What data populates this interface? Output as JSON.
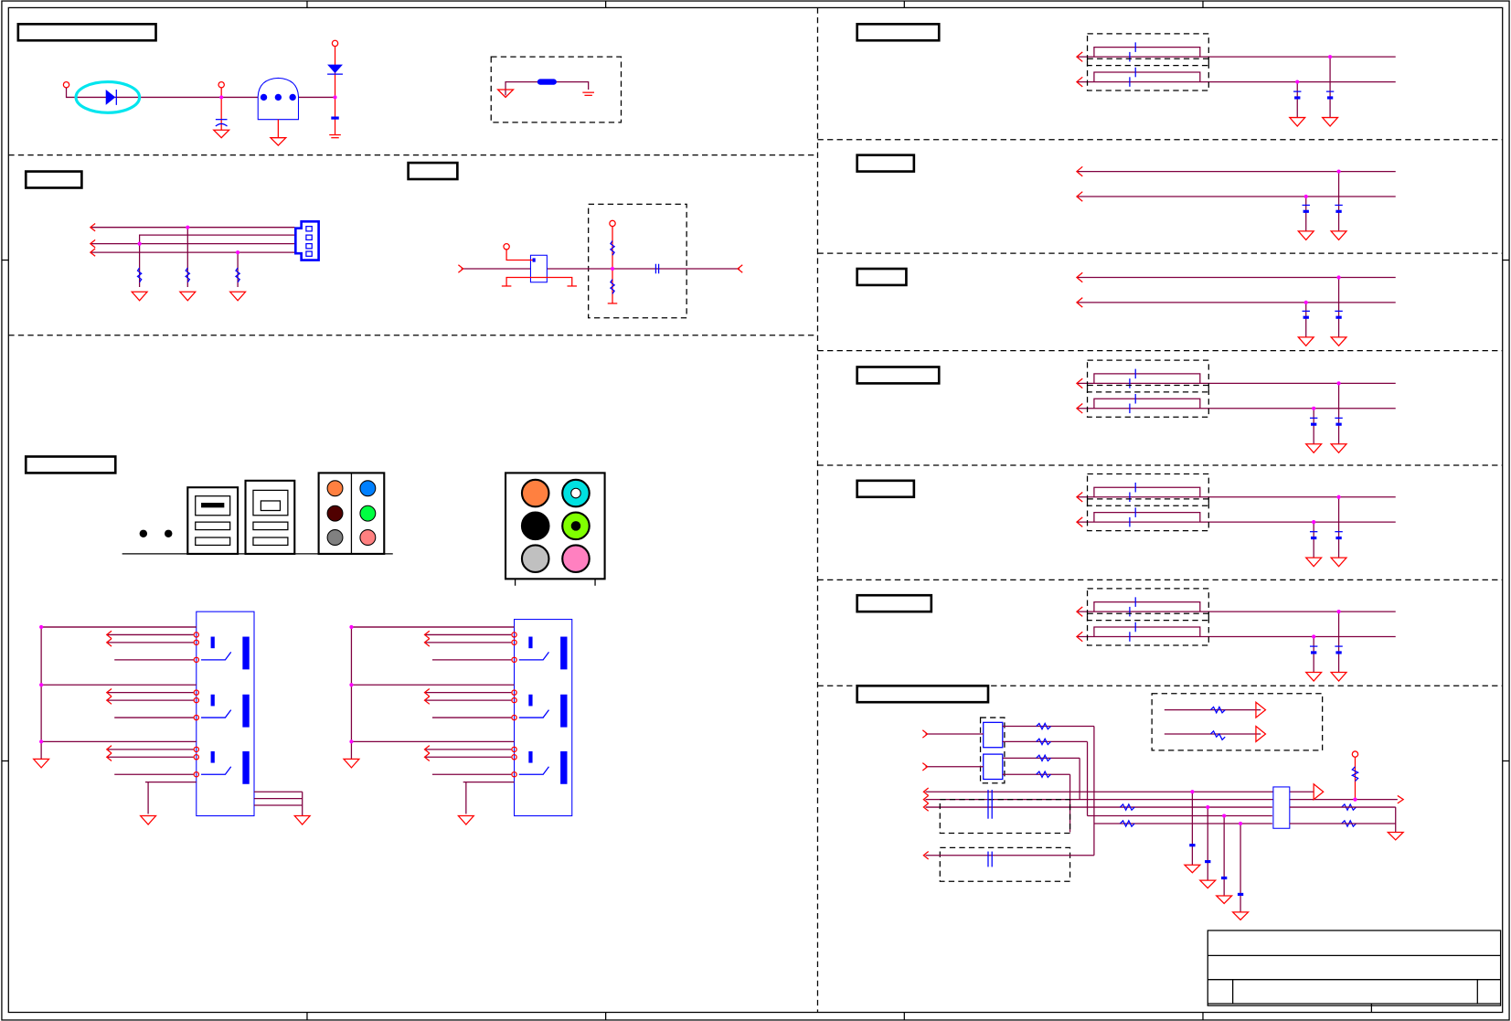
{
  "sheet": {
    "kind": "schematic",
    "colors": {
      "wire": "#800040",
      "pin": "#ff0000",
      "part": "#0000ff",
      "junction": "#ff00ff",
      "highlight": "#00e5ee",
      "frame": "#000000"
    },
    "audio_jacks_small": [
      "#ff8040",
      "#0080ff",
      "#500000",
      "#00ff40",
      "#808080",
      "#ff8080"
    ],
    "audio_jacks_large": [
      "#ff8040",
      "#00e0e0",
      "#000000",
      "#80ff00",
      "#c0c0c0",
      "#ff80c0"
    ]
  }
}
